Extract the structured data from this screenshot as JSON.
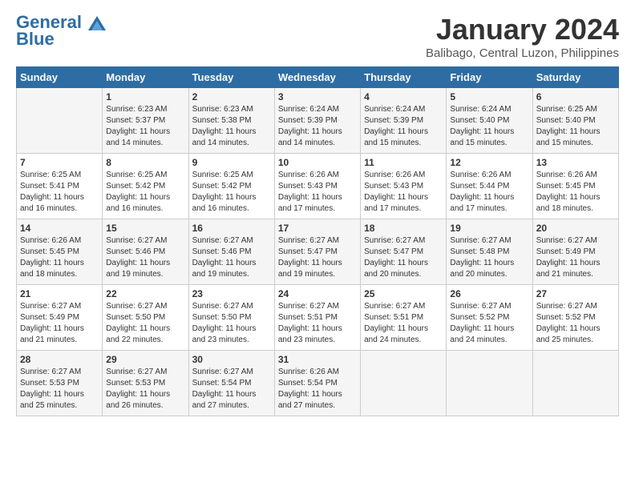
{
  "header": {
    "logo_line1": "General",
    "logo_line2": "Blue",
    "month": "January 2024",
    "location": "Balibago, Central Luzon, Philippines"
  },
  "days_of_week": [
    "Sunday",
    "Monday",
    "Tuesday",
    "Wednesday",
    "Thursday",
    "Friday",
    "Saturday"
  ],
  "weeks": [
    [
      {
        "day": "",
        "info": ""
      },
      {
        "day": "1",
        "info": "Sunrise: 6:23 AM\nSunset: 5:37 PM\nDaylight: 11 hours\nand 14 minutes."
      },
      {
        "day": "2",
        "info": "Sunrise: 6:23 AM\nSunset: 5:38 PM\nDaylight: 11 hours\nand 14 minutes."
      },
      {
        "day": "3",
        "info": "Sunrise: 6:24 AM\nSunset: 5:39 PM\nDaylight: 11 hours\nand 14 minutes."
      },
      {
        "day": "4",
        "info": "Sunrise: 6:24 AM\nSunset: 5:39 PM\nDaylight: 11 hours\nand 15 minutes."
      },
      {
        "day": "5",
        "info": "Sunrise: 6:24 AM\nSunset: 5:40 PM\nDaylight: 11 hours\nand 15 minutes."
      },
      {
        "day": "6",
        "info": "Sunrise: 6:25 AM\nSunset: 5:40 PM\nDaylight: 11 hours\nand 15 minutes."
      }
    ],
    [
      {
        "day": "7",
        "info": "Sunrise: 6:25 AM\nSunset: 5:41 PM\nDaylight: 11 hours\nand 16 minutes."
      },
      {
        "day": "8",
        "info": "Sunrise: 6:25 AM\nSunset: 5:42 PM\nDaylight: 11 hours\nand 16 minutes."
      },
      {
        "day": "9",
        "info": "Sunrise: 6:25 AM\nSunset: 5:42 PM\nDaylight: 11 hours\nand 16 minutes."
      },
      {
        "day": "10",
        "info": "Sunrise: 6:26 AM\nSunset: 5:43 PM\nDaylight: 11 hours\nand 17 minutes."
      },
      {
        "day": "11",
        "info": "Sunrise: 6:26 AM\nSunset: 5:43 PM\nDaylight: 11 hours\nand 17 minutes."
      },
      {
        "day": "12",
        "info": "Sunrise: 6:26 AM\nSunset: 5:44 PM\nDaylight: 11 hours\nand 17 minutes."
      },
      {
        "day": "13",
        "info": "Sunrise: 6:26 AM\nSunset: 5:45 PM\nDaylight: 11 hours\nand 18 minutes."
      }
    ],
    [
      {
        "day": "14",
        "info": "Sunrise: 6:26 AM\nSunset: 5:45 PM\nDaylight: 11 hours\nand 18 minutes."
      },
      {
        "day": "15",
        "info": "Sunrise: 6:27 AM\nSunset: 5:46 PM\nDaylight: 11 hours\nand 19 minutes."
      },
      {
        "day": "16",
        "info": "Sunrise: 6:27 AM\nSunset: 5:46 PM\nDaylight: 11 hours\nand 19 minutes."
      },
      {
        "day": "17",
        "info": "Sunrise: 6:27 AM\nSunset: 5:47 PM\nDaylight: 11 hours\nand 19 minutes."
      },
      {
        "day": "18",
        "info": "Sunrise: 6:27 AM\nSunset: 5:47 PM\nDaylight: 11 hours\nand 20 minutes."
      },
      {
        "day": "19",
        "info": "Sunrise: 6:27 AM\nSunset: 5:48 PM\nDaylight: 11 hours\nand 20 minutes."
      },
      {
        "day": "20",
        "info": "Sunrise: 6:27 AM\nSunset: 5:49 PM\nDaylight: 11 hours\nand 21 minutes."
      }
    ],
    [
      {
        "day": "21",
        "info": "Sunrise: 6:27 AM\nSunset: 5:49 PM\nDaylight: 11 hours\nand 21 minutes."
      },
      {
        "day": "22",
        "info": "Sunrise: 6:27 AM\nSunset: 5:50 PM\nDaylight: 11 hours\nand 22 minutes."
      },
      {
        "day": "23",
        "info": "Sunrise: 6:27 AM\nSunset: 5:50 PM\nDaylight: 11 hours\nand 23 minutes."
      },
      {
        "day": "24",
        "info": "Sunrise: 6:27 AM\nSunset: 5:51 PM\nDaylight: 11 hours\nand 23 minutes."
      },
      {
        "day": "25",
        "info": "Sunrise: 6:27 AM\nSunset: 5:51 PM\nDaylight: 11 hours\nand 24 minutes."
      },
      {
        "day": "26",
        "info": "Sunrise: 6:27 AM\nSunset: 5:52 PM\nDaylight: 11 hours\nand 24 minutes."
      },
      {
        "day": "27",
        "info": "Sunrise: 6:27 AM\nSunset: 5:52 PM\nDaylight: 11 hours\nand 25 minutes."
      }
    ],
    [
      {
        "day": "28",
        "info": "Sunrise: 6:27 AM\nSunset: 5:53 PM\nDaylight: 11 hours\nand 25 minutes."
      },
      {
        "day": "29",
        "info": "Sunrise: 6:27 AM\nSunset: 5:53 PM\nDaylight: 11 hours\nand 26 minutes."
      },
      {
        "day": "30",
        "info": "Sunrise: 6:27 AM\nSunset: 5:54 PM\nDaylight: 11 hours\nand 27 minutes."
      },
      {
        "day": "31",
        "info": "Sunrise: 6:26 AM\nSunset: 5:54 PM\nDaylight: 11 hours\nand 27 minutes."
      },
      {
        "day": "",
        "info": ""
      },
      {
        "day": "",
        "info": ""
      },
      {
        "day": "",
        "info": ""
      }
    ]
  ]
}
